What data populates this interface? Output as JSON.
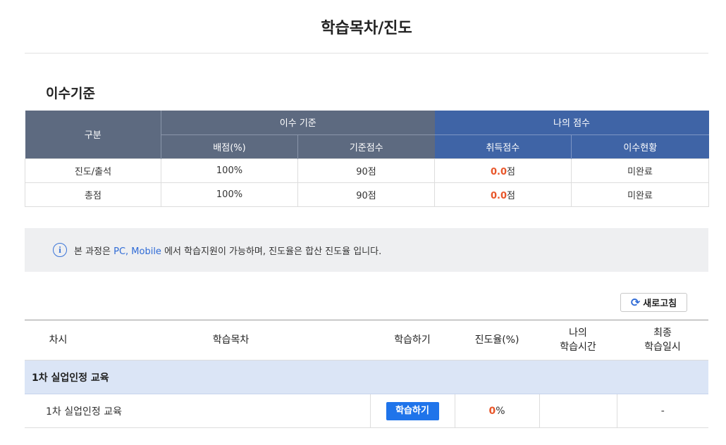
{
  "page": {
    "title": "학습목차/진도"
  },
  "criteria": {
    "section_title": "이수기준",
    "header": {
      "category": "구분",
      "criteria_group": "이수 기준",
      "my_score_group": "나의 점수",
      "weight": "배점(%)",
      "base_score": "기준점수",
      "earned_score": "취득점수",
      "status": "이수현황"
    },
    "rows": [
      {
        "category": "진도/출석",
        "weight": "100%",
        "base_score": "90점",
        "earned_value": "0.0",
        "earned_unit": "점",
        "status": "미완료"
      },
      {
        "category": "총점",
        "weight": "100%",
        "base_score": "90점",
        "earned_value": "0.0",
        "earned_unit": "점",
        "status": "미완료"
      }
    ]
  },
  "info": {
    "icon": "info-icon",
    "text_before": "본 과정은 ",
    "highlight": "PC, Mobile",
    "text_after": " 에서 학습지원이 가능하며, 진도율은 합산 진도율 입니다."
  },
  "refresh": {
    "label": "새로고침",
    "icon": "refresh-icon"
  },
  "progress": {
    "headers": {
      "session": "차시",
      "contents": "학습목차",
      "study": "학습하기",
      "rate": "진도율(%)",
      "my_time_line1": "나의",
      "my_time_line2": "학습시간",
      "last_line1": "최종",
      "last_line2": "학습일시"
    },
    "group": {
      "label": "1차 실업인정 교육"
    },
    "rows": [
      {
        "name": "1차 실업인정 교육",
        "button": "학습하기",
        "rate_value": "0",
        "rate_unit": "%",
        "my_time": "",
        "last_study": "-"
      }
    ]
  },
  "colors": {
    "header_dark": "#5d6a80",
    "header_blue": "#3f64a6",
    "accent_orange": "#e8562a",
    "accent_blue": "#1f74ea",
    "group_row_bg": "#dbe5f6",
    "info_bg": "#eeeff1"
  }
}
